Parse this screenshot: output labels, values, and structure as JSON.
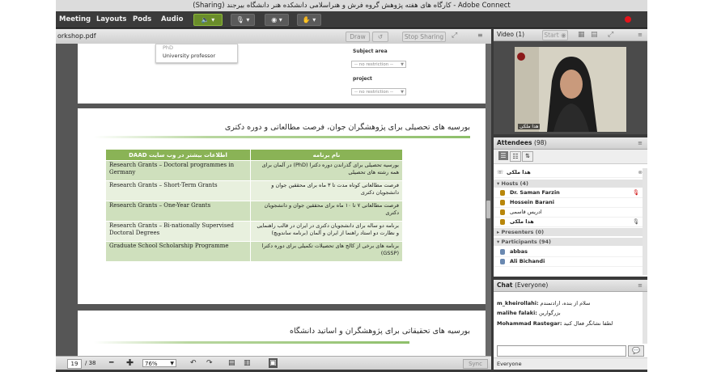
{
  "window": {
    "title": "(Sharing) کارگاه های هفته پژوهش گروه فرش و هنراسلامی دانشکده هنر دانشگاه بیرجند - Adobe Connect"
  },
  "menu": {
    "items": [
      "Meeting",
      "Layouts",
      "Pods",
      "Audio"
    ],
    "toolbar_arrow": "▾"
  },
  "share_pod": {
    "filename": "orkshop.pdf",
    "buttons": {
      "draw": "Draw",
      "stop_sharing": "Stop Sharing"
    },
    "top_page": {
      "dropdown_items": [
        "PhD",
        "University professor"
      ],
      "subject_label": "Subject area",
      "project_label": "project",
      "select_placeholder": "-- no restriction --"
    },
    "slide1": {
      "title": "بورسیه های تحصیلی برای پژوهشگران جوان، فرصت مطالعاتی و دوره دکتری",
      "table": {
        "headers": [
          "اطلاعات بیشتر در وب سایت DAAD",
          "نام برنامه"
        ],
        "rows": [
          {
            "en": "Research Grants – Doctoral programmes in Germany",
            "fa": "بورسیه تحصیلی برای گذراندن دوره دکترا (PhD) در آلمان برای همه رشته های تحصیلی"
          },
          {
            "en": "Research Grants – Short-Term Grants",
            "fa": "فرصت مطالعاتی کوتاه مدت تا ۳ ماه برای محققین جوان و دانشجویان دکتری"
          },
          {
            "en": "Research Grants – One-Year Grants",
            "fa": "فرصت مطالعاتی ۷ تا ۱۰ ماه برای محققین جوان و دانشجویان دکتری"
          },
          {
            "en": "Research Grants – Bi-nationally Supervised Doctoral Degrees",
            "fa": "برنامه دو ساله برای دانشجویان دکتری در ایران در قالب راهنمایی و نظارت دو استاد راهنما از ایران و آلمان (برنامه ساندویچ)"
          },
          {
            "en": "Graduate School Scholarship Programme",
            "fa": "برنامه های برخی از کالج های تحصیلات تکمیلی برای دوره دکترا (GSSP)"
          }
        ]
      }
    },
    "slide2": {
      "title": "بورسیه های تحقیقاتی برای پژوهشگران و اساتید دانشگاه"
    },
    "footer": {
      "page": "19",
      "total": "/ 38",
      "zoom": "76%",
      "sync": "Sync"
    }
  },
  "video_pod": {
    "title": "Video",
    "count": "(1)",
    "start_label": "Start",
    "caption": "هدا ملکی"
  },
  "attendees_pod": {
    "title": "Attendees",
    "count": "(98)",
    "self_name": "هدا ملکی",
    "hosts_label": "Hosts (4)",
    "hosts": [
      "Dr. Saman Farzin",
      "Hossein Barani",
      "ادریس قاسمی",
      "هدا ملکی"
    ],
    "presenters_label": "Presenters (0)",
    "participants_label": "Participants (94)",
    "participants": [
      "abbas",
      "Ali Bichandi"
    ]
  },
  "chat_pod": {
    "title": "Chat",
    "audience": "(Everyone)",
    "messages": [
      {
        "sender": "m_kheirollahi:",
        "text": "سلام از بنده، ارادتمندم"
      },
      {
        "sender": "malihe falaki:",
        "text": "بزرگوارین"
      },
      {
        "sender": "Mohammad Rastegar:",
        "text": "لطفا نشانگر فعال کنید"
      }
    ],
    "tab": "Everyone"
  },
  "colors": {
    "table_header": "#8ab356",
    "table_row_dark": "#cfe0bd",
    "table_row_light": "#e8f0de",
    "record": "#e4141b"
  }
}
